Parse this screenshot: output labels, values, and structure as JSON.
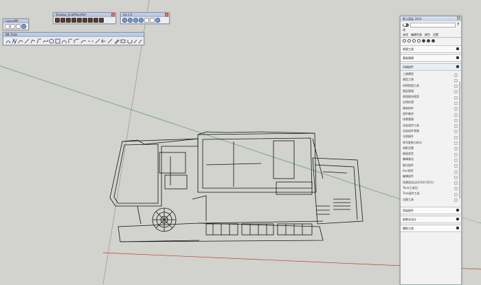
{
  "toolbars": {
    "layout": {
      "title": "LayoutMl"
    },
    "shadow": {
      "title": "Shadow_Grid/Plan/Ref"
    },
    "mini": {
      "title": "Lib 1.0"
    },
    "drawing": {
      "title": "BB_Tools"
    }
  },
  "tray": {
    "title": "默认面板 2024",
    "search_placeholder": "",
    "help_glyph": "?",
    "label_row": "线",
    "tabs": [
      "选项",
      "编辑列表",
      "颜色",
      "设置"
    ],
    "sections": [
      {
        "label": "视图工具"
      },
      {
        "label": "基础建模"
      },
      {
        "label": "风格插件"
      }
    ],
    "items": [
      "三维模型",
      "建造工具",
      "材质贴图工具",
      "图层管理",
      "表面填充图案",
      "边线处理",
      "建筑构件",
      "组件集合",
      "场景管理",
      "动态组件工具",
      "动态组件表格",
      "光照插件",
      "阵列复制与拆分",
      "阴影设置",
      "曲面造型",
      "编辑柔化",
      "推拉插件",
      "Sun地形",
      "编辑组件",
      "场景面导出(2018-2021)",
      "Tools工具包",
      "Trim插件工具",
      "出图工具"
    ],
    "bottom_sections": [
      {
        "label": "渲染插件"
      },
      {
        "label": "参数化设计"
      },
      {
        "label": "辅助工具"
      }
    ]
  },
  "icons": {
    "layout": [
      "page-icon",
      "frame-icon",
      "layers-icon",
      "globe-icon"
    ],
    "shadow": [
      "shadow-icon-1",
      "shadow-icon-2",
      "shadow-icon-3",
      "shadow-icon-4",
      "shadow-icon-5",
      "shadow-icon-6",
      "shadow-icon-7",
      "shadow-icon-8",
      "shadow-icon-9"
    ],
    "mini": [
      "orbit-icon",
      "pan-icon",
      "walk-icon",
      "grid-icon",
      "play-icon",
      "stop-icon",
      "refresh-icon"
    ],
    "drawing": [
      "arc-icon",
      "zigzag-icon",
      "curve-icon",
      "line-icon",
      "polyline-icon",
      "bend-icon",
      "spline-icon",
      "circle-icon",
      "rect-icon",
      "offset-icon",
      "fillet-icon",
      "chamfer-icon",
      "join-icon",
      "break-icon",
      "extend-icon",
      "trim-icon",
      "divide-icon",
      "pen-icon",
      "erase-icon",
      "magnet-icon",
      "brush-icon",
      "brush2-icon"
    ]
  },
  "colors": {
    "background": "#d2d2ce",
    "accent": "#3e5f8e"
  }
}
